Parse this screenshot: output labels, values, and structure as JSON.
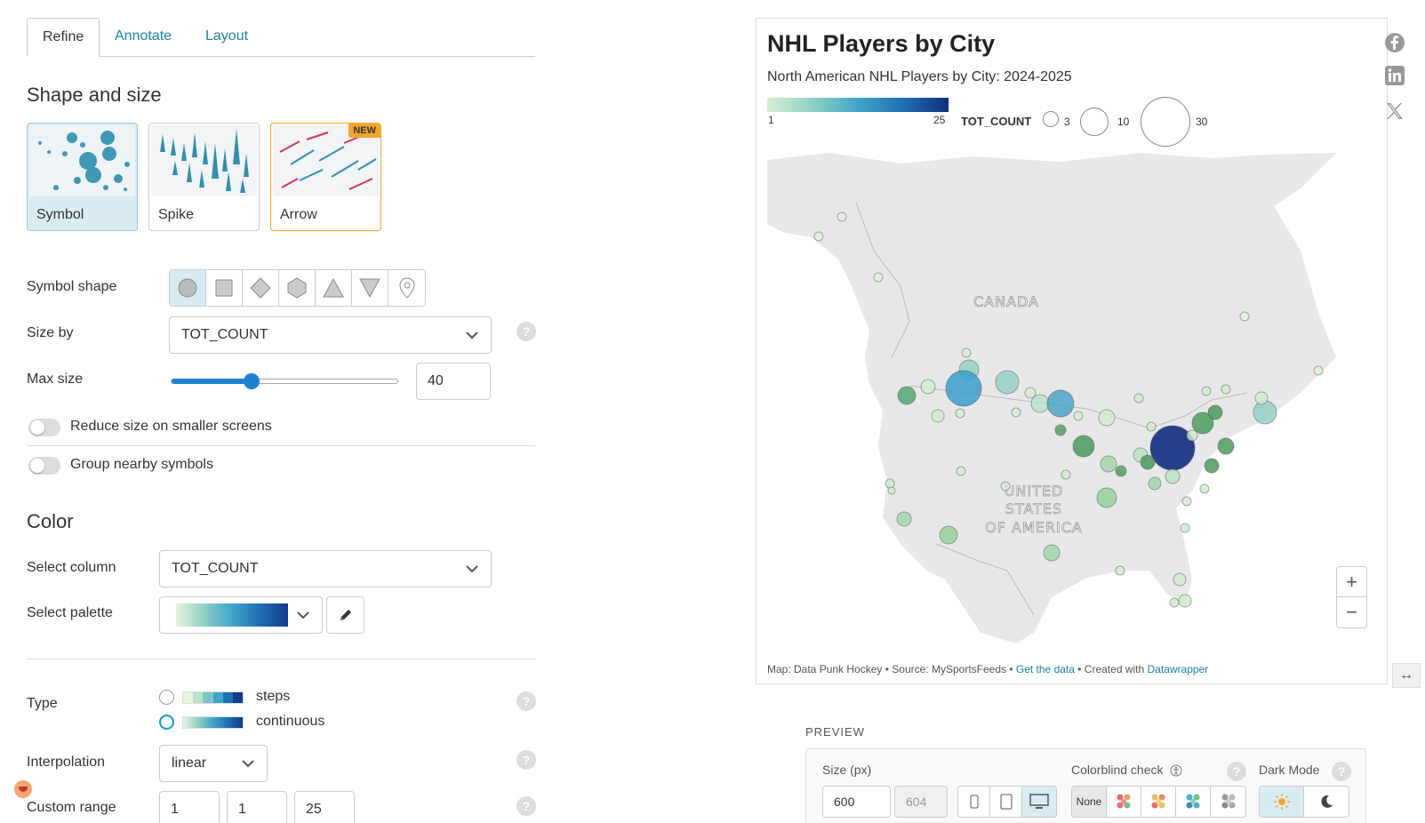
{
  "tabs": [
    {
      "label": "Refine",
      "active": true
    },
    {
      "label": "Annotate",
      "active": false
    },
    {
      "label": "Layout",
      "active": false
    }
  ],
  "shape_size": {
    "heading": "Shape and size",
    "cards": [
      {
        "label": "Symbol",
        "selected": true
      },
      {
        "label": "Spike",
        "selected": false
      },
      {
        "label": "Arrow",
        "selected": false,
        "badge": "NEW"
      }
    ],
    "symbol_shape_label": "Symbol shape",
    "symbol_shapes": [
      "circle-icon",
      "square-icon",
      "diamond-icon",
      "hexagon-icon",
      "triangle-up-icon",
      "triangle-down-icon",
      "marker-icon"
    ],
    "size_by_label": "Size by",
    "size_by_value": "TOT_COUNT",
    "max_size_label": "Max size",
    "max_size_value": "40",
    "max_size_slider_fraction": 0.35,
    "reduce_label": "Reduce size on smaller screens",
    "group_label": "Group nearby symbols"
  },
  "color": {
    "heading": "Color",
    "select_column_label": "Select column",
    "select_column_value": "TOT_COUNT",
    "select_palette_label": "Select palette",
    "type_label": "Type",
    "type_options": [
      "steps",
      "continuous"
    ],
    "type_selected": "continuous",
    "interpolation_label": "Interpolation",
    "interpolation_value": "linear",
    "custom_range_label": "Custom range",
    "custom_range_values": [
      "1",
      "1",
      "25"
    ]
  },
  "chart": {
    "title": "NHL Players by City",
    "subtitle": "North American NHL Players by City: 2024-2025",
    "legend_color_min": "1",
    "legend_color_max": "25",
    "legend_size_label": "TOT_COUNT",
    "legend_sizes": [
      "3",
      "10",
      "30"
    ],
    "map_labels": {
      "canada": "CANADA",
      "usa_1": "UNITED",
      "usa_2": "STATES",
      "usa_3": "OF AMERICA"
    },
    "footer_map": "Map: Data Punk Hockey",
    "footer_source": "Source: MySportsFeeds",
    "footer_get_data": "Get the data",
    "footer_created": "Created with",
    "footer_dw": "Datawrapper",
    "zoom_in": "+",
    "zoom_out": "−",
    "colors": {
      "low": "#d6f0d2",
      "mid": "#3fa6c8",
      "high": "#102e80",
      "land": "#e8e8e8"
    }
  },
  "preview": {
    "label": "PREVIEW",
    "size_label": "Size (px)",
    "width": "600",
    "height": "604",
    "colorblind_label": "Colorblind check",
    "colorblind_none": "None",
    "dark_mode_label": "Dark Mode"
  }
}
